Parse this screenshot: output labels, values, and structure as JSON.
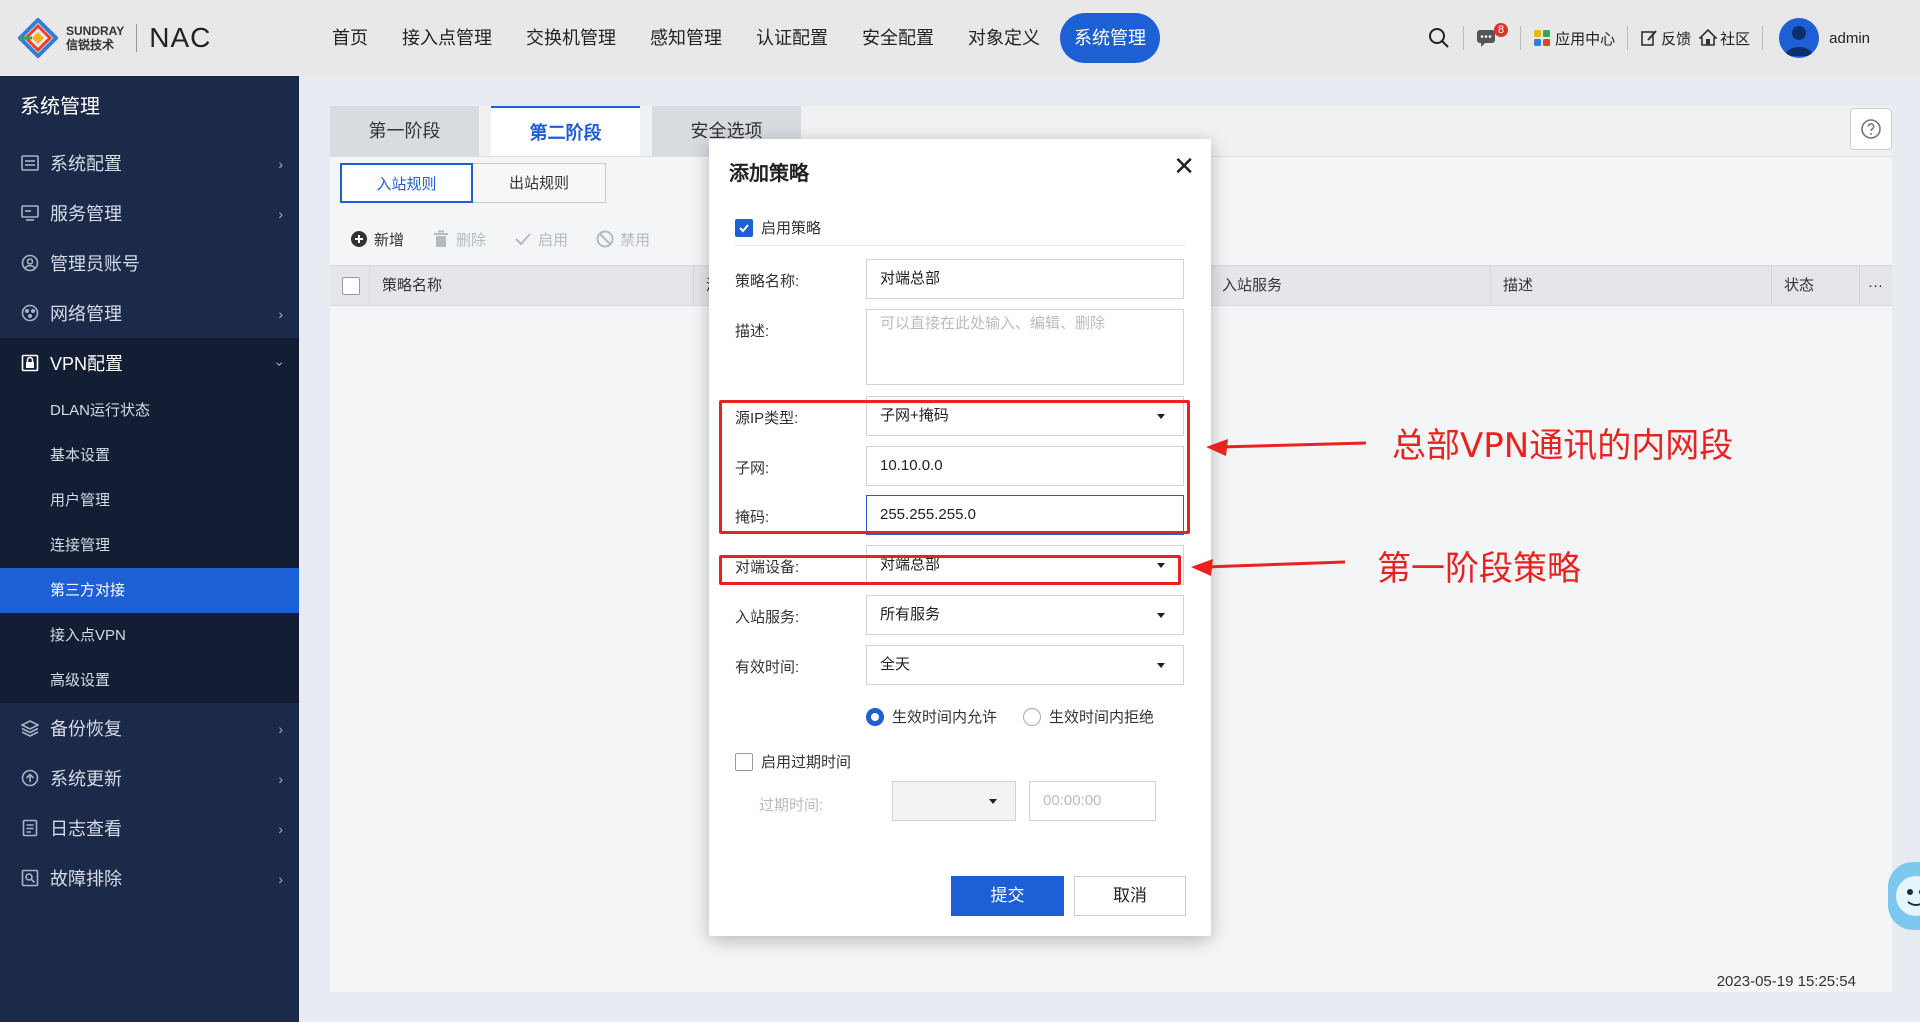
{
  "brand": {
    "line1": "SUNDRAY",
    "line2": "信锐技术",
    "product": "NAC"
  },
  "nav": {
    "items": [
      {
        "label": "首页"
      },
      {
        "label": "接入点管理"
      },
      {
        "label": "交换机管理"
      },
      {
        "label": "感知管理"
      },
      {
        "label": "认证配置"
      },
      {
        "label": "安全配置"
      },
      {
        "label": "对象定义"
      },
      {
        "label": "系统管理"
      }
    ],
    "active": "系统管理"
  },
  "topright": {
    "message_count": "8",
    "app_center": "应用中心",
    "feedback": "反馈",
    "community": "社区",
    "user": "admin"
  },
  "sidebar": {
    "title": "系统管理",
    "items": [
      {
        "label": "系统配置"
      },
      {
        "label": "服务管理"
      },
      {
        "label": "管理员账号"
      },
      {
        "label": "网络管理"
      },
      {
        "label": "VPN配置"
      },
      {
        "label": "备份恢复"
      },
      {
        "label": "系统更新"
      },
      {
        "label": "日志查看"
      },
      {
        "label": "故障排除"
      }
    ],
    "vpn_sub": [
      {
        "label": "DLAN运行状态"
      },
      {
        "label": "基本设置"
      },
      {
        "label": "用户管理"
      },
      {
        "label": "连接管理"
      },
      {
        "label": "第三方对接"
      },
      {
        "label": "接入点VPN"
      },
      {
        "label": "高级设置"
      }
    ],
    "active_sub": "第三方对接"
  },
  "stage_tabs": [
    "第一阶段",
    "第二阶段",
    "安全选项"
  ],
  "active_stage": "第二阶段",
  "subtabs": [
    "入站规则",
    "出站规则"
  ],
  "toolbar": {
    "add": "新增",
    "delete": "删除",
    "enable": "启用",
    "disable": "禁用"
  },
  "table": {
    "columns": [
      "策略名称",
      "源IP",
      "入站服务",
      "描述",
      "状态",
      "···"
    ]
  },
  "timestamp": "2023-05-19 15:25:54",
  "dialog": {
    "title": "添加策略",
    "close": "✕",
    "enable_label": "启用策略",
    "fields": {
      "name_label": "策略名称:",
      "name_value": "对端总部",
      "desc_label": "描述:",
      "desc_placeholder": "可以直接在此处输入、编辑、删除",
      "src_type_label": "源IP类型:",
      "src_type_value": "子网+掩码",
      "subnet_label": "子网:",
      "subnet_value": "10.10.0.0",
      "mask_label": "掩码:",
      "mask_value": "255.255.255.0",
      "peer_label": "对端设备:",
      "peer_value": "对端总部",
      "service_label": "入站服务:",
      "service_value": "所有服务",
      "time_label": "有效时间:",
      "time_value": "全天"
    },
    "radio": {
      "allow": "生效时间内允许",
      "deny": "生效时间内拒绝"
    },
    "expire": {
      "enable_label": "启用过期时间",
      "time_label": "过期时间:",
      "time_value": "00:00:00"
    },
    "submit": "提交",
    "cancel": "取消"
  },
  "annotations": {
    "note1": "总部VPN通讯的内网段",
    "note2": "第一阶段策略",
    "color": "#e8231f"
  },
  "colors": {
    "accent": "#1d5fd4",
    "sidebar_bg": "#1c2a49"
  }
}
